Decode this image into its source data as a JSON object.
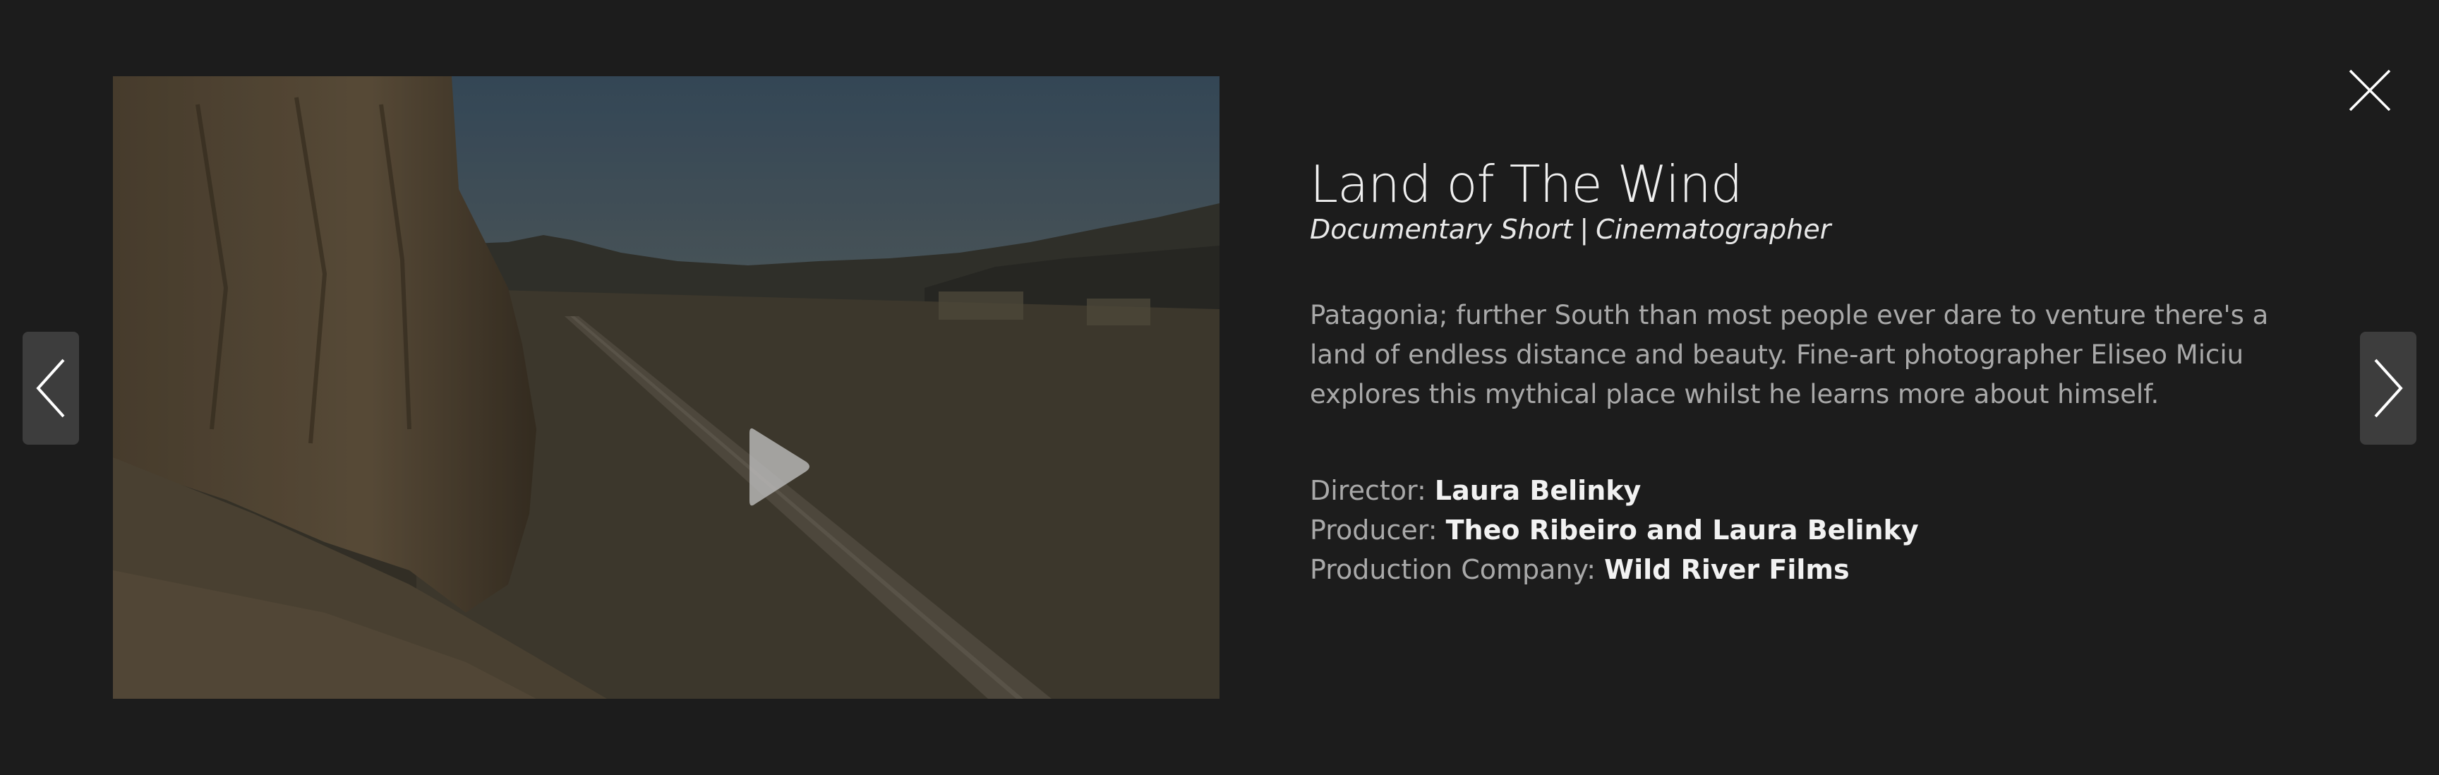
{
  "project": {
    "title": "Land of The Wind",
    "category": "Documentary Short",
    "role": "Cinematographer",
    "separator": "|",
    "description": "Patagonia; further South than most people ever dare to venture there's a land of endless distance and beauty. Fine-art photographer Eliseo Miciu explores this mythical place whilst he learns more about himself."
  },
  "credits": [
    {
      "label": "Director:",
      "value": "Laura Belinky"
    },
    {
      "label": "Producer:",
      "value": "Theo Ribeiro and Laura Belinky"
    },
    {
      "label": "Production Company:",
      "value": "Wild River Films"
    }
  ],
  "icons": {
    "play": "play-icon",
    "prev": "chevron-left-icon",
    "next": "chevron-right-icon",
    "close": "close-icon"
  },
  "colors": {
    "background": "#1c1c1c",
    "title_text": "#f0f0f0",
    "body_text": "#a9a9a9",
    "nav_button": "#3d3d3d"
  }
}
